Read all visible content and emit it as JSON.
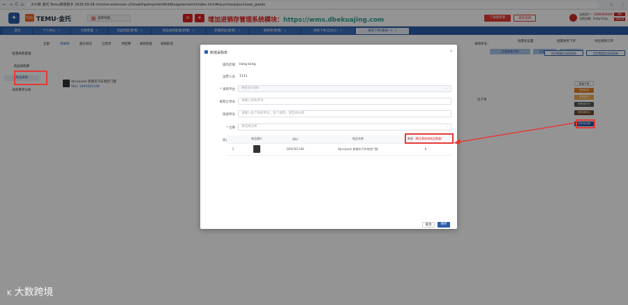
{
  "browser": {
    "address": "大众数 金托 Temu跨境助手 2026.09.06   chrome-extension://hiisakthpdmpmkhfdhbfbsagoiemiehh/index.html#/purchase/purchase_goods",
    "nav": [
      "←",
      "→",
      "C",
      "⌂"
    ]
  },
  "topbar": {
    "temu_tag": "TEMU",
    "brand": "TEMU·金托",
    "menu_label": "菜单导航",
    "promo_text": "增加进销存管理系统模块：",
    "promo_url": "https://wms.dbekuajing.com",
    "btn1": "下载最新版",
    "btn2": "更新说明",
    "user_line1_label": "当前用户：",
    "user_line1_value": "18888888888",
    "user_line2_label": "当前店铺：",
    "user_line2_value": "liang kiing",
    "user_tag1": "退出",
    "user_tag2": "切换店铺"
  },
  "tabs": [
    "首页",
    "个人中心",
    "仓库管理",
    "货品档案(新增)",
    "商品采购管理(新增)",
    "店铺商品(新增)",
    "采购单(新增)",
    "采购下单(自动三)",
    "采购下单(模式一)"
  ],
  "sidebar": [
    "批量采购管理",
    "商品采购库",
    "商品采购",
    "采购库存分析"
  ],
  "background": {
    "filter_tabs": [
      "全部",
      "待采购",
      "部分到仓",
      "已到货",
      "待结算",
      "采购完成",
      "采购取消"
    ],
    "order_label": "采购单号：",
    "right_btns": [
      "批量查看详情",
      "批量导出",
      "导出数据"
    ],
    "right_tab_labels": [
      "批量化设置",
      "批量财务下单",
      "导出采购订单"
    ],
    "right_tab_labels2": [
      "同步数据生成采购单",
      "同步数据生成采购单"
    ],
    "product_name": "4pcs/pack 新能车汽车电控门锁",
    "product_sku": "SKU: 3495561108",
    "product_status": "已下单",
    "right_buttons": [
      "批量下单",
      "采购核算",
      "采购统计",
      "采购单打印",
      "采购单导出",
      "采购单详情"
    ]
  },
  "modal": {
    "title": "新增采购单",
    "fields": [
      {
        "label": "操作店铺",
        "required": false,
        "value": "liang kiing"
      },
      {
        "label": "运营人员",
        "required": false,
        "value": "1111"
      },
      {
        "label": "采购平台",
        "required": true,
        "placeholder": "拼多多1688"
      },
      {
        "label": "采购订单号",
        "required": false,
        "placeholder": "请输入采购单号"
      },
      {
        "label": "快递单号",
        "required": false,
        "placeholder": "请输入多个快递单号，多个请用，或空格分隔"
      },
      {
        "label": "仓库",
        "required": true,
        "placeholder": "请选择仓库"
      }
    ],
    "goods_label": "商品明细",
    "table": {
      "headers": [
        "",
        "商品图片",
        "SKU",
        "商品名称",
        "数量"
      ],
      "qty_header": "数量",
      "qty_hint": "（需注意修改商品数量）",
      "rows": [
        {
          "idx": "1",
          "sku": "3495561108",
          "name": "4pcs/pack 新能车汽车电控门锁",
          "qty": "6"
        }
      ]
    },
    "cancel": "取消",
    "save": "保存"
  },
  "watermark": "大数跨境",
  "watermark_mark": "K"
}
